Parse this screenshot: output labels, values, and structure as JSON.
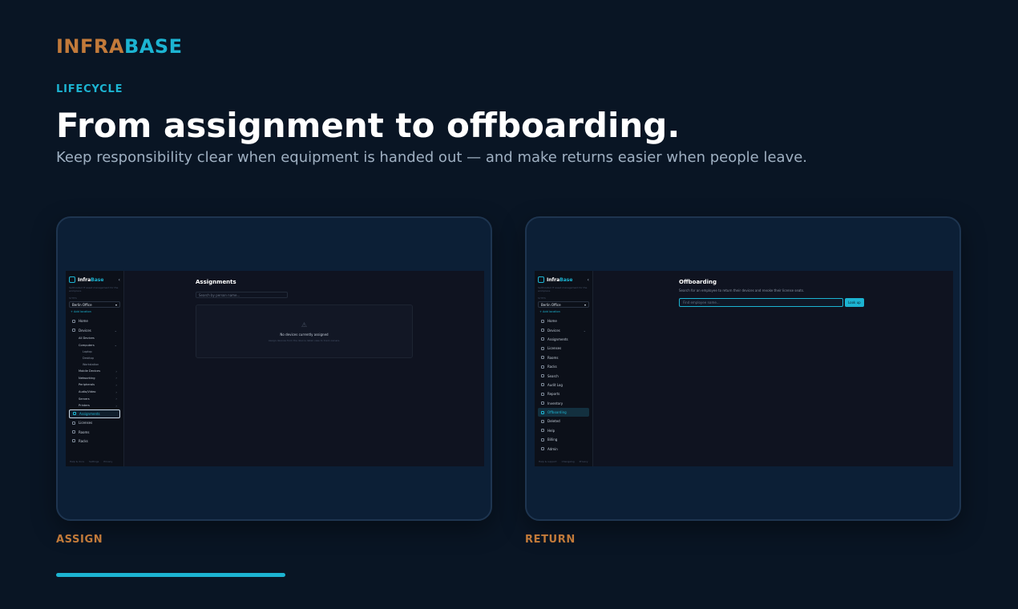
{
  "brand": {
    "part1": "INFRA",
    "part2": "BASE"
  },
  "section": {
    "eyebrow": "LIFECYCLE",
    "headline": "From assignment to offboarding.",
    "subtitle": "Keep responsibility clear when equipment is handed out — and make returns easier when people leave."
  },
  "cards": {
    "assign": {
      "caption": "ASSIGN",
      "app": {
        "logo_a": "Infra",
        "logo_b": "Base",
        "tagline": "Self-hosted IT asset management for the workplace",
        "site_label": "SITES",
        "site": "Berlin Office",
        "add_location": "+ Add location",
        "nav": [
          {
            "label": "Home"
          },
          {
            "label": "Devices"
          },
          {
            "label": "All Devices"
          },
          {
            "label": "Computers"
          },
          {
            "label": "Laptop"
          },
          {
            "label": "Desktop"
          },
          {
            "label": "Workstation"
          },
          {
            "label": "Mobile Devices"
          },
          {
            "label": "Networking"
          },
          {
            "label": "Peripherals"
          },
          {
            "label": "Audio/Video"
          },
          {
            "label": "Servers"
          },
          {
            "label": "Printers"
          },
          {
            "label": "Assignments"
          },
          {
            "label": "Licenses"
          },
          {
            "label": "Rooms"
          },
          {
            "label": "Racks"
          }
        ],
        "footer": [
          "Help & docs",
          "Settings",
          "Privacy"
        ],
        "page_title": "Assignments",
        "search_placeholder": "Search by person name...",
        "empty_title": "No devices currently assigned",
        "empty_desc": "Assign devices from the device detail view to track owners."
      }
    },
    "return": {
      "caption": "RETURN",
      "app": {
        "logo_a": "Infra",
        "logo_b": "Base",
        "tagline": "Self-hosted IT asset management for the workplace",
        "site_label": "SITES",
        "site": "Berlin Office",
        "add_location": "+ Add location",
        "nav": [
          {
            "label": "Home"
          },
          {
            "label": "Devices"
          },
          {
            "label": "Assignments"
          },
          {
            "label": "Licenses"
          },
          {
            "label": "Rooms"
          },
          {
            "label": "Racks"
          },
          {
            "label": "Search"
          },
          {
            "label": "Audit Log"
          },
          {
            "label": "Reports"
          },
          {
            "label": "Inventory"
          },
          {
            "label": "Offboarding"
          },
          {
            "label": "Deleted"
          },
          {
            "label": "Help"
          },
          {
            "label": "Billing"
          },
          {
            "label": "Admin"
          }
        ],
        "footer": [
          "Help & support",
          "Changelog",
          "Privacy"
        ],
        "page_title": "Offboarding",
        "page_desc": "Search for an employee to return their devices and revoke their license seats.",
        "input_placeholder": "Find employee name...",
        "lookup_label": "Look up"
      }
    }
  },
  "colors": {
    "background": "#091524",
    "accent": "#1cb4d2",
    "brand_orange": "#c27a3a"
  }
}
